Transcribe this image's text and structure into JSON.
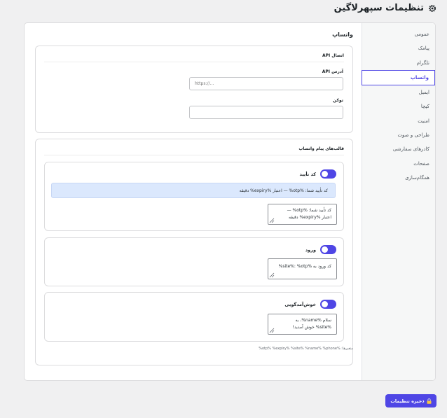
{
  "page": {
    "title": "تنظیمات سپهرلاگین",
    "icon": "gear-icon"
  },
  "sidebar": {
    "items": [
      {
        "label": "عمومی"
      },
      {
        "label": "پیامک"
      },
      {
        "label": "تلگرام"
      },
      {
        "label": "واتساپ",
        "active": true
      },
      {
        "label": "ایمیل"
      },
      {
        "label": "کپچا"
      },
      {
        "label": "امنیت"
      },
      {
        "label": "طراحی و صوت"
      },
      {
        "label": "کادرهای سفارشی"
      },
      {
        "label": "صفحات"
      },
      {
        "label": "همگام‌سازی"
      }
    ]
  },
  "main": {
    "section_title": "واتساپ",
    "connection": {
      "title": "اتصال API",
      "api_address_label": "آدرس API",
      "api_address_placeholder": "https://...",
      "token_label": "توکن",
      "token_value": ""
    },
    "templates": {
      "title": "قالب‌های پیام واتساپ",
      "items": [
        {
          "name": "کد تأیید",
          "enabled": true,
          "preview": "کد تأیید شما: %otp% — اعتبار %expiry% دقیقه",
          "text_lines": [
            "کد تأیید شما: %otp% —",
            "اعتبار %expiry% دقیقه"
          ]
        },
        {
          "name": "ورود",
          "enabled": true,
          "text_lines": [
            "کد ورود به %site%: %otp%"
          ]
        },
        {
          "name": "خوش‌آمدگویی",
          "enabled": true,
          "text_lines": [
            "سلام %name%، به",
            "%site% خوش آمدید!"
          ]
        }
      ],
      "variables_hint": "متغیرها: %otp% %expiry% %site% %name% %phone%"
    }
  },
  "footer": {
    "save_label": "ذخیره تنظیمات",
    "save_icon": "lock-icon"
  },
  "colors": {
    "accent": "#4f46e5",
    "preview_bg": "#dbe8fd",
    "page_bg": "#f0f0f1"
  }
}
